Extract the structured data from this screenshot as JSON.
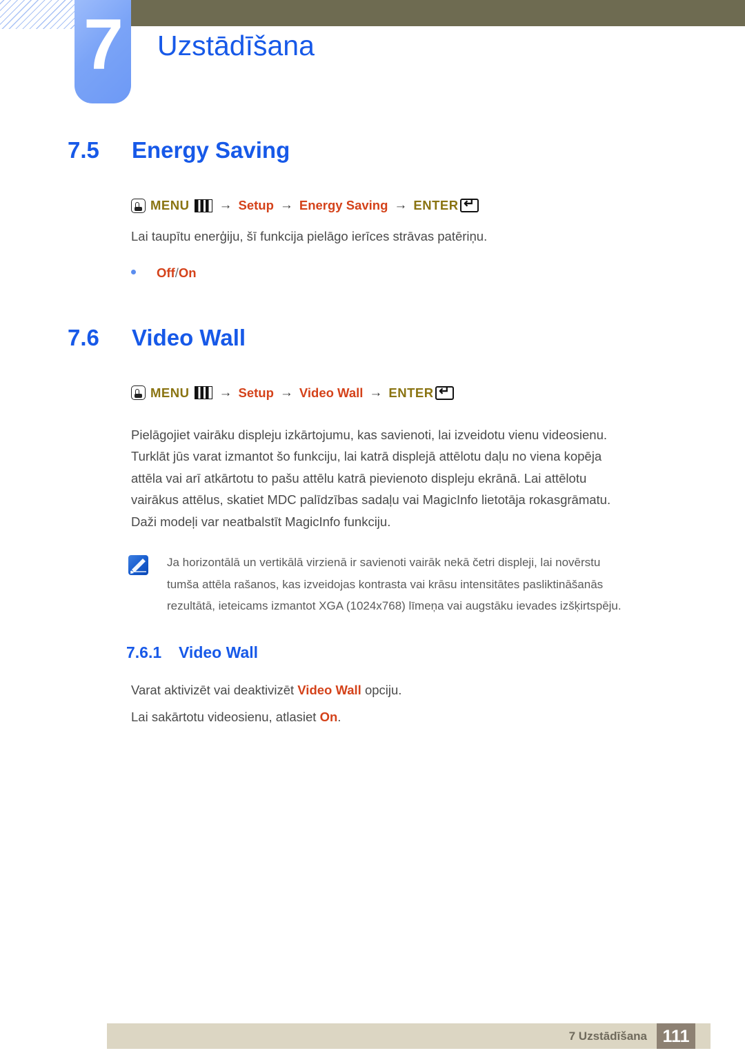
{
  "header": {
    "chapter_number": "7",
    "chapter_title": "Uzstādīšana",
    "accent_blue": "#1759e8",
    "tab_blue": "#7ba4f7",
    "olive_bar": "#6e6b51"
  },
  "sections": {
    "energy_saving": {
      "number": "7.5",
      "title": "Energy Saving",
      "menu_path": {
        "hand_icon": "hand-press-icon",
        "menu_label": "MENU",
        "menu_icon": "menu-bars-icon",
        "arrow": "→",
        "step1": "Setup",
        "step2": "Energy Saving",
        "enter_label": "ENTER",
        "enter_icon": "enter-key-icon"
      },
      "description": "Lai taupītu enerģiju, šī funkcija pielāgo ierīces strāvas patēriņu.",
      "option_off": "Off",
      "option_separator": "/",
      "option_on": "On"
    },
    "video_wall": {
      "number": "7.6",
      "title": "Video Wall",
      "menu_path": {
        "hand_icon": "hand-press-icon",
        "menu_label": "MENU",
        "menu_icon": "menu-bars-icon",
        "arrow": "→",
        "step1": "Setup",
        "step2": "Video Wall",
        "enter_label": "ENTER",
        "enter_icon": "enter-key-icon"
      },
      "body": "Pielāgojiet vairāku displeju izkārtojumu, kas savienoti, lai izveidotu vienu videosienu. Turklāt jūs varat izmantot šo funkciju, lai katrā displejā attēlotu daļu no viena kopēja attēla vai arī atkārtotu to pašu attēlu katrā pievienoto displeju ekrānā. Lai attēlotu vairākus attēlus, skatiet MDC palīdzības sadaļu vai MagicInfo lietotāja rokasgrāmatu. Daži modeļi var neatbalstīt MagicInfo funkciju.",
      "note": {
        "icon": "note-pencil-icon",
        "text": "Ja horizontālā un vertikālā virzienā ir savienoti vairāk nekā četri displeji, lai novērstu tumša attēla rašanos, kas izveidojas kontrasta vai krāsu intensitātes pasliktināšanās rezultātā, ieteicams izmantot XGA (1024x768) līmeņa vai augstāku ievades izšķirtspēju."
      },
      "subsection": {
        "number": "7.6.1",
        "title": "Video Wall",
        "line1_pre": "Varat aktivizēt vai deaktivizēt ",
        "line1_bold": "Video Wall",
        "line1_post": " opciju.",
        "line2_pre": "Lai sakārtotu videosienu, atlasiet ",
        "line2_bold": "On",
        "line2_post": "."
      }
    }
  },
  "footer": {
    "label": "7 Uzstādīšana",
    "page_number": "111",
    "bar_color": "#dcd6c3",
    "page_block_color": "#8d8173"
  }
}
